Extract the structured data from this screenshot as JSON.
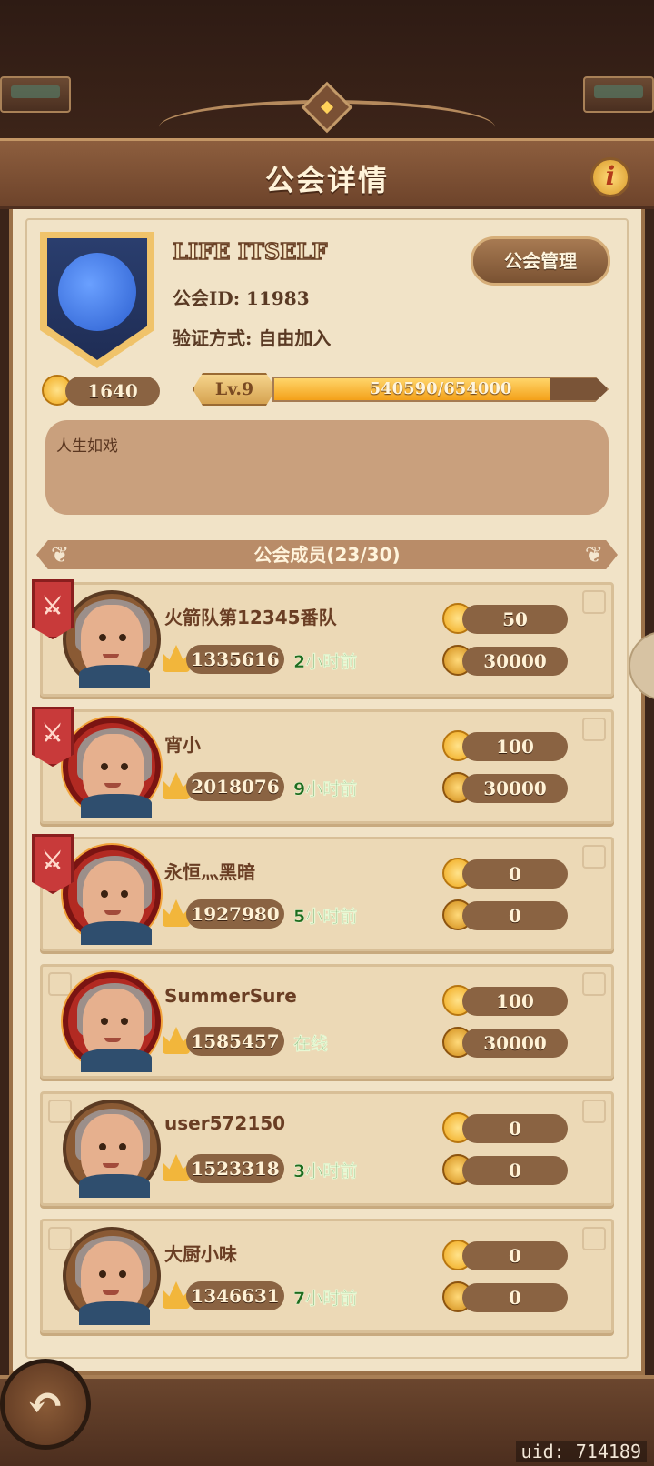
{
  "header": {
    "title": "公会详情",
    "info_label": "i"
  },
  "guild": {
    "name": "LIFE ITSELF",
    "id_line": "公会ID: 11983",
    "verify_line": "验证方式: 自由加入",
    "manage_label": "公会管理",
    "coins": "1640",
    "level": "Lv.9",
    "xp_text": "540590/654000",
    "xp_progress": 0.8266,
    "notice": "人生如戏"
  },
  "members_section": {
    "title": "公会成员(23/30)"
  },
  "members": [
    {
      "name": "火箭队第12345番队",
      "power": "1335616",
      "last_seen": "2小时前",
      "contribution": "50",
      "gold": "30000",
      "rank_badge": "⚔",
      "vip": false
    },
    {
      "name": "宵小",
      "power": "2018076",
      "last_seen": "9小时前",
      "contribution": "100",
      "gold": "30000",
      "rank_badge": "⚔",
      "vip": true
    },
    {
      "name": "永恒灬黑暗",
      "power": "1927980",
      "last_seen": "5小时前",
      "contribution": "0",
      "gold": "0",
      "rank_badge": "⚔",
      "vip": true
    },
    {
      "name": "SummerSure",
      "power": "1585457",
      "last_seen": "在线",
      "contribution": "100",
      "gold": "30000",
      "rank_badge": "",
      "vip": true
    },
    {
      "name": "user572150",
      "power": "1523318",
      "last_seen": "3小时前",
      "contribution": "0",
      "gold": "0",
      "rank_badge": "",
      "vip": false
    },
    {
      "name": "大厨小味",
      "power": "1346631",
      "last_seen": "7小时前",
      "contribution": "0",
      "gold": "0",
      "rank_badge": "",
      "vip": false
    }
  ],
  "footer": {
    "back_icon": "↶",
    "uid": "uid: 714189"
  },
  "colors": {
    "accent_gold": "#f4a119",
    "panel_bg": "#f1e3c7",
    "online_green": "#1e6b1e"
  }
}
